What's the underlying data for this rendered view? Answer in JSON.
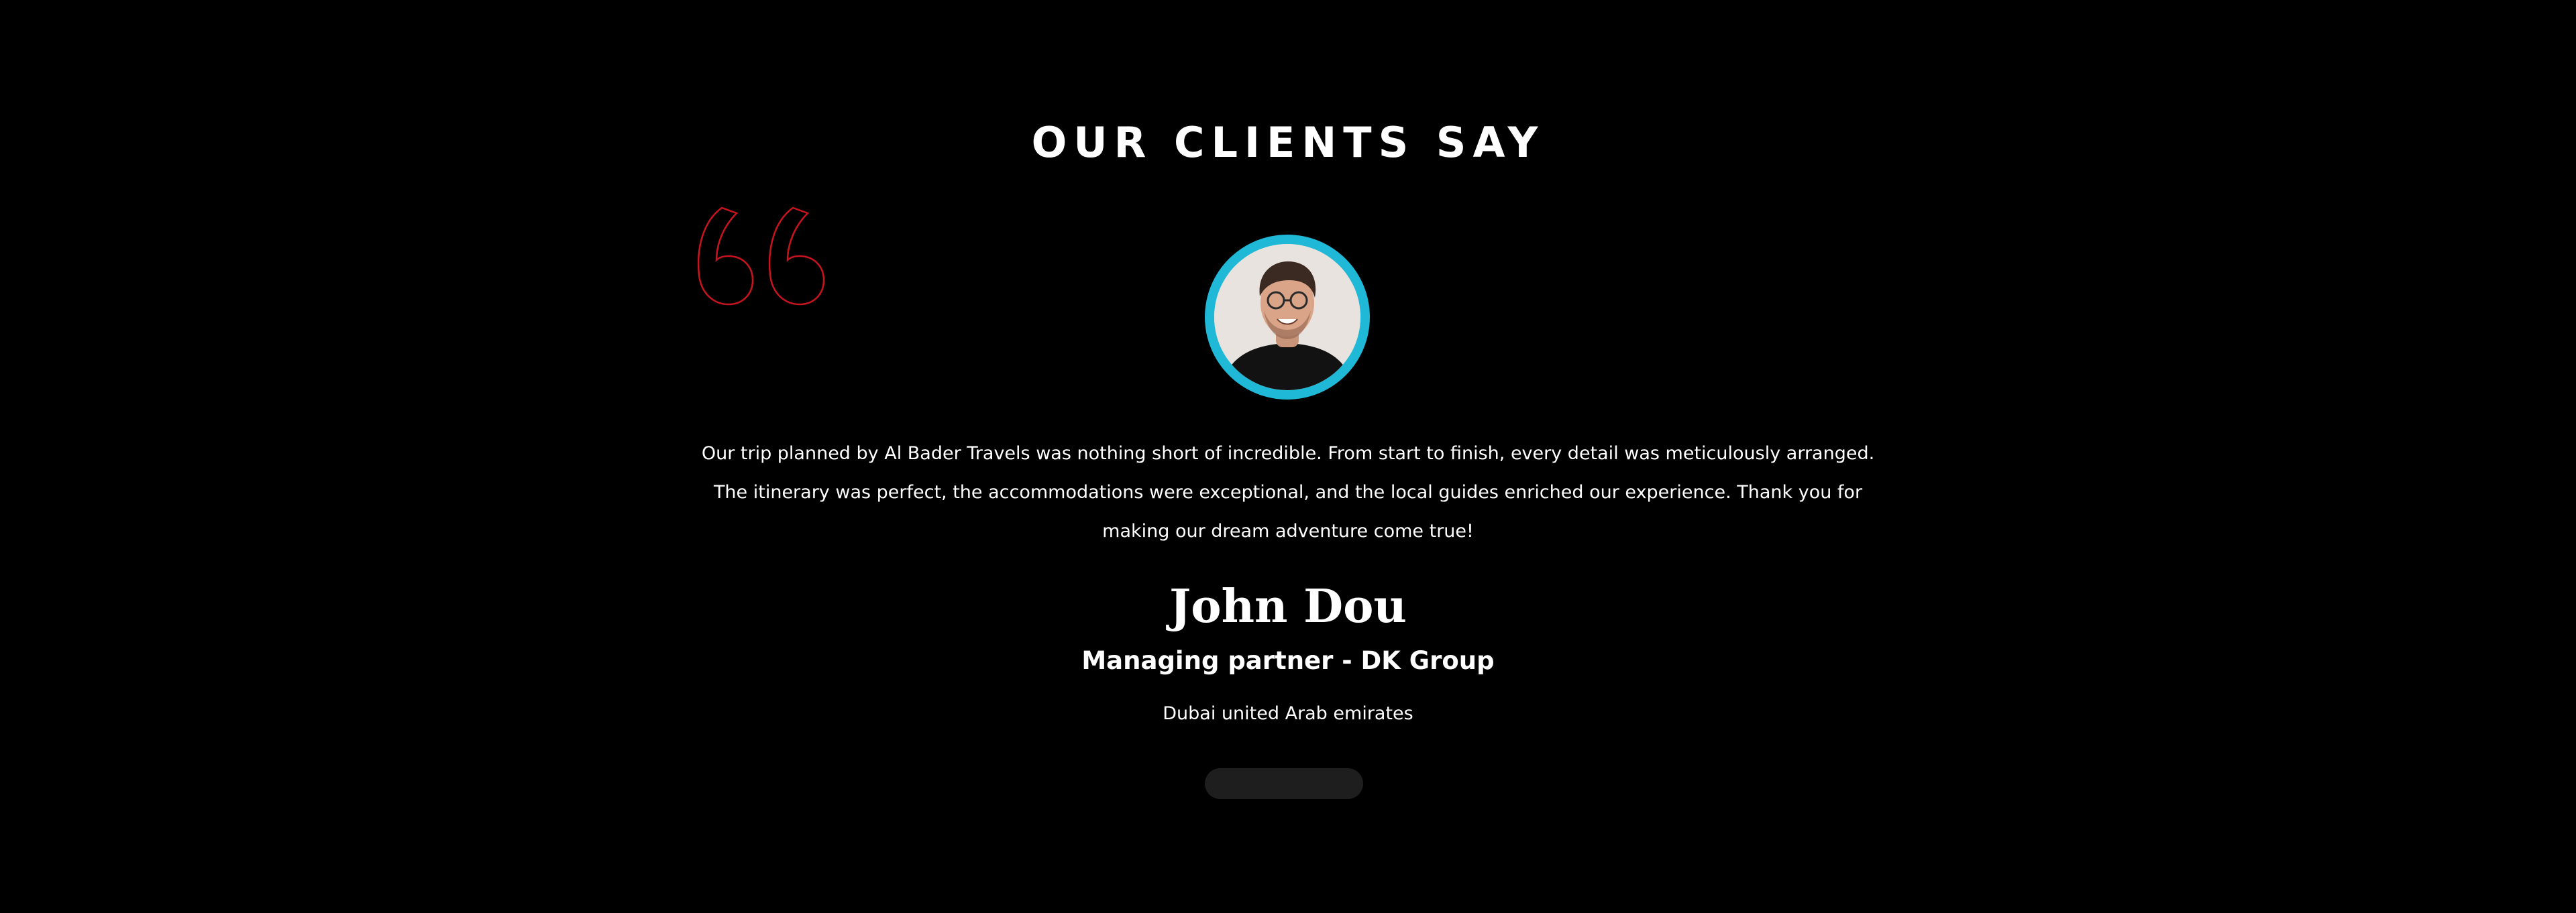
{
  "section": {
    "heading": "OUR CLIENTS SAY"
  },
  "colors": {
    "background": "#000000",
    "text": "#ffffff",
    "quote_accent": "#c8141e",
    "avatar_ring": "#1fb8d6",
    "pager": "#1e1e1e"
  },
  "icons": {
    "quote": "quote-icon"
  },
  "testimonial": {
    "text": "Our trip planned by Al Bader Travels was nothing short of incredible. From start to finish, every detail was meticulously arranged. The itinerary was perfect, the accommodations were exceptional, and the local guides enriched our experience. Thank you for making our dream adventure come true!",
    "author_name": "John Dou",
    "author_role": "Managing partner - DK Group",
    "author_location": "Dubai united Arab emirates"
  }
}
